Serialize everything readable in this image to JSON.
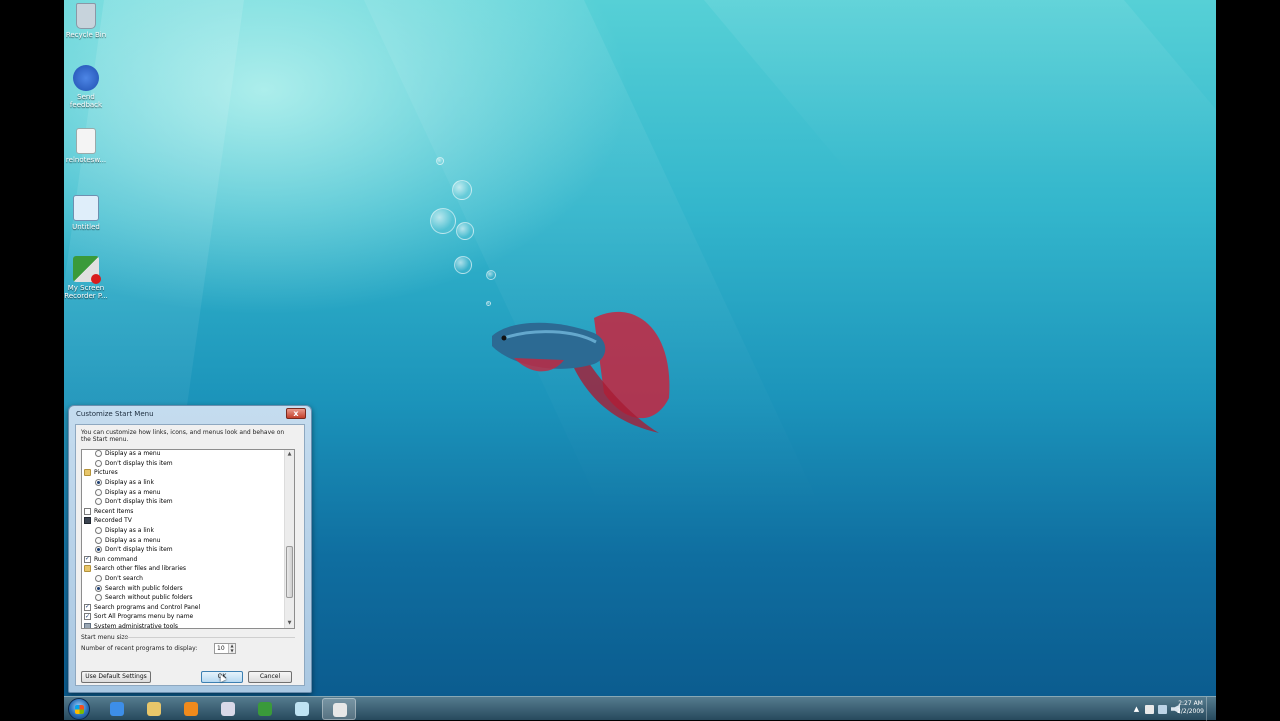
{
  "desktop": {
    "icons": [
      {
        "label": "Recycle Bin",
        "color": "#c7d3dc"
      },
      {
        "label": "Send feedback",
        "color": "#2f64c8"
      },
      {
        "label": "relnotesw...",
        "color": "#f4f4f4"
      },
      {
        "label": "Untitled",
        "color": "#dfeefa"
      },
      {
        "label": "My Screen Recorder P...",
        "color": "#3a9a3a"
      }
    ]
  },
  "dialog": {
    "title": "Customize Start Menu",
    "close_label": "x",
    "description": "You can customize how links, icons, and menus look and behave on the Start menu.",
    "items": [
      {
        "level": 1,
        "control": "radio",
        "checked": false,
        "label": "Display as a menu"
      },
      {
        "level": 1,
        "control": "radio",
        "checked": false,
        "label": "Don't display this item"
      },
      {
        "level": 0,
        "control": "folder",
        "label": "Pictures"
      },
      {
        "level": 1,
        "control": "radio",
        "checked": true,
        "label": "Display as a link"
      },
      {
        "level": 1,
        "control": "radio",
        "checked": false,
        "label": "Display as a menu"
      },
      {
        "level": 1,
        "control": "radio",
        "checked": false,
        "label": "Don't display this item"
      },
      {
        "level": 0,
        "control": "checkbox",
        "checked": false,
        "label": "Recent Items"
      },
      {
        "level": 0,
        "control": "tv",
        "label": "Recorded TV"
      },
      {
        "level": 1,
        "control": "radio",
        "checked": false,
        "label": "Display as a link"
      },
      {
        "level": 1,
        "control": "radio",
        "checked": false,
        "label": "Display as a menu"
      },
      {
        "level": 1,
        "control": "radio",
        "checked": true,
        "label": "Don't display this item"
      },
      {
        "level": 0,
        "control": "checkbox",
        "checked": true,
        "label": "Run command"
      },
      {
        "level": 0,
        "control": "folder",
        "label": "Search other files and libraries"
      },
      {
        "level": 1,
        "control": "radio",
        "checked": false,
        "label": "Don't search"
      },
      {
        "level": 1,
        "control": "radio",
        "checked": true,
        "label": "Search with public folders"
      },
      {
        "level": 1,
        "control": "radio",
        "checked": false,
        "label": "Search without public folders"
      },
      {
        "level": 0,
        "control": "checkbox",
        "checked": true,
        "label": "Search programs and Control Panel"
      },
      {
        "level": 0,
        "control": "checkbox",
        "checked": true,
        "label": "Sort All Programs menu by name"
      },
      {
        "level": 0,
        "control": "gear",
        "label": "System administrative tools"
      }
    ],
    "start_menu_size_legend": "Start menu size",
    "recent_programs_label": "Number of recent programs to display:",
    "recent_programs_value": "10",
    "use_default_label": "Use Default Settings",
    "ok_label": "OK",
    "cancel_label": "Cancel"
  },
  "taskbar": {
    "pinned": [
      {
        "icon": "internet-explorer-icon",
        "color": "#3d8ee8"
      },
      {
        "icon": "windows-explorer-icon",
        "color": "#e8c66a"
      },
      {
        "icon": "media-player-icon",
        "color": "#f08a1c"
      },
      {
        "icon": "paint-icon",
        "color": "#d9d9e8"
      },
      {
        "icon": "screen-recorder-icon",
        "color": "#3a9a3a"
      },
      {
        "icon": "notepad-icon",
        "color": "#bfe3f2"
      },
      {
        "icon": "customize-window-icon",
        "color": "#e7e7e7"
      }
    ],
    "clock_time": "2:27 AM",
    "clock_date": "2/2/2009"
  }
}
